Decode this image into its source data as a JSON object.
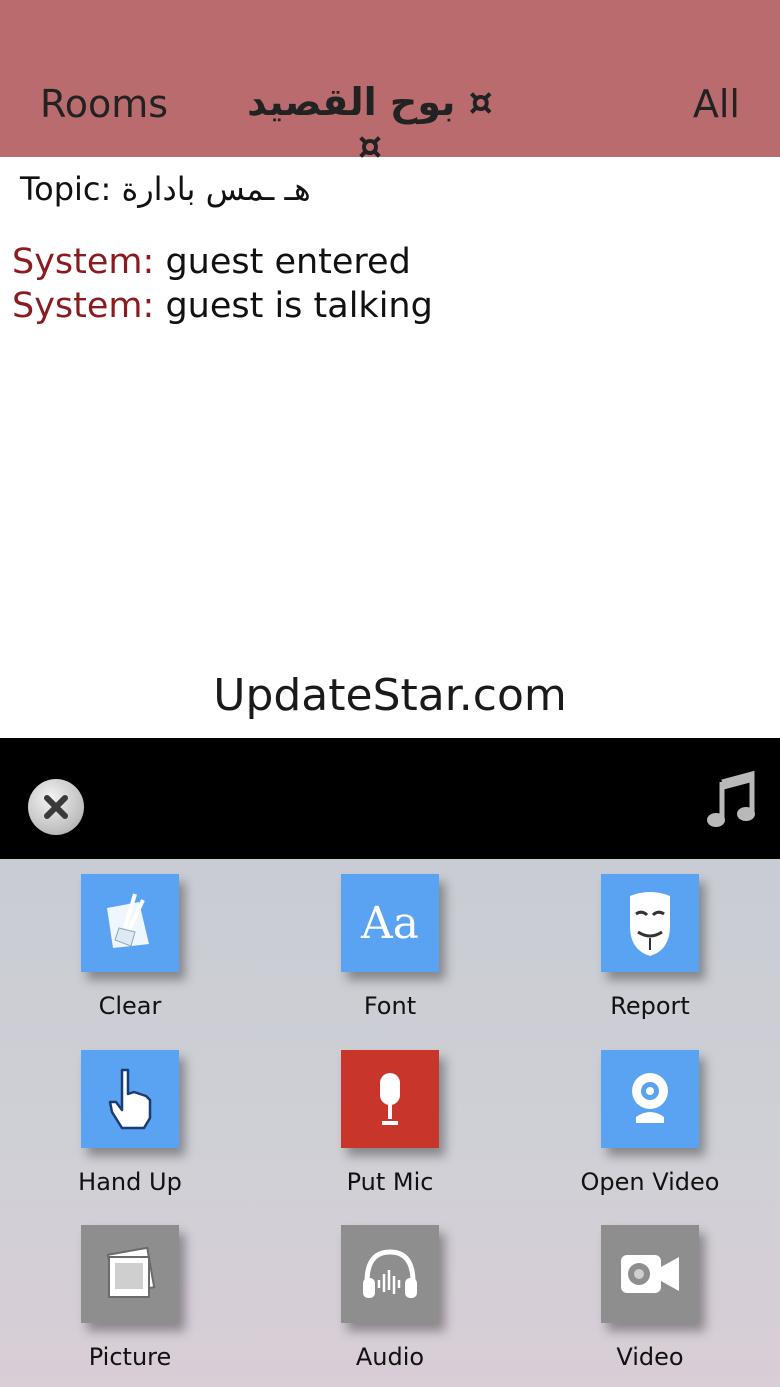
{
  "header": {
    "rooms_label": "Rooms",
    "room_title": "¤ بوح القصيد ¤",
    "all_label": "All",
    "background": "#b96b6d"
  },
  "topic": "Topic: هـ ـمس    بادارة",
  "messages": [
    {
      "sender": "System:",
      "text": " guest entered"
    },
    {
      "sender": "System:",
      "text": " guest is talking"
    }
  ],
  "watermark": "UpdateStar.com",
  "toolbar": {
    "close_icon": "close-icon",
    "music_icon": "music-note-icon"
  },
  "actions": [
    {
      "label": "Clear",
      "icon": "broom-icon",
      "color": "#5aa2f2"
    },
    {
      "label": "Font",
      "icon": "font-aa-icon",
      "color": "#5aa2f2"
    },
    {
      "label": "Report",
      "icon": "mask-icon",
      "color": "#5aa2f2"
    },
    {
      "label": "Hand Up",
      "icon": "hand-pointer-icon",
      "color": "#5aa2f2"
    },
    {
      "label": "Put Mic",
      "icon": "microphone-icon",
      "color": "#c8352a"
    },
    {
      "label": "Open Video",
      "icon": "webcam-icon",
      "color": "#5aa2f2"
    },
    {
      "label": "Picture",
      "icon": "photos-icon",
      "color": "#8e8e8e"
    },
    {
      "label": "Audio",
      "icon": "headphones-icon",
      "color": "#8e8e8e"
    },
    {
      "label": "Video",
      "icon": "video-camera-icon",
      "color": "#8e8e8e"
    }
  ],
  "font_icon_text": "Aa"
}
